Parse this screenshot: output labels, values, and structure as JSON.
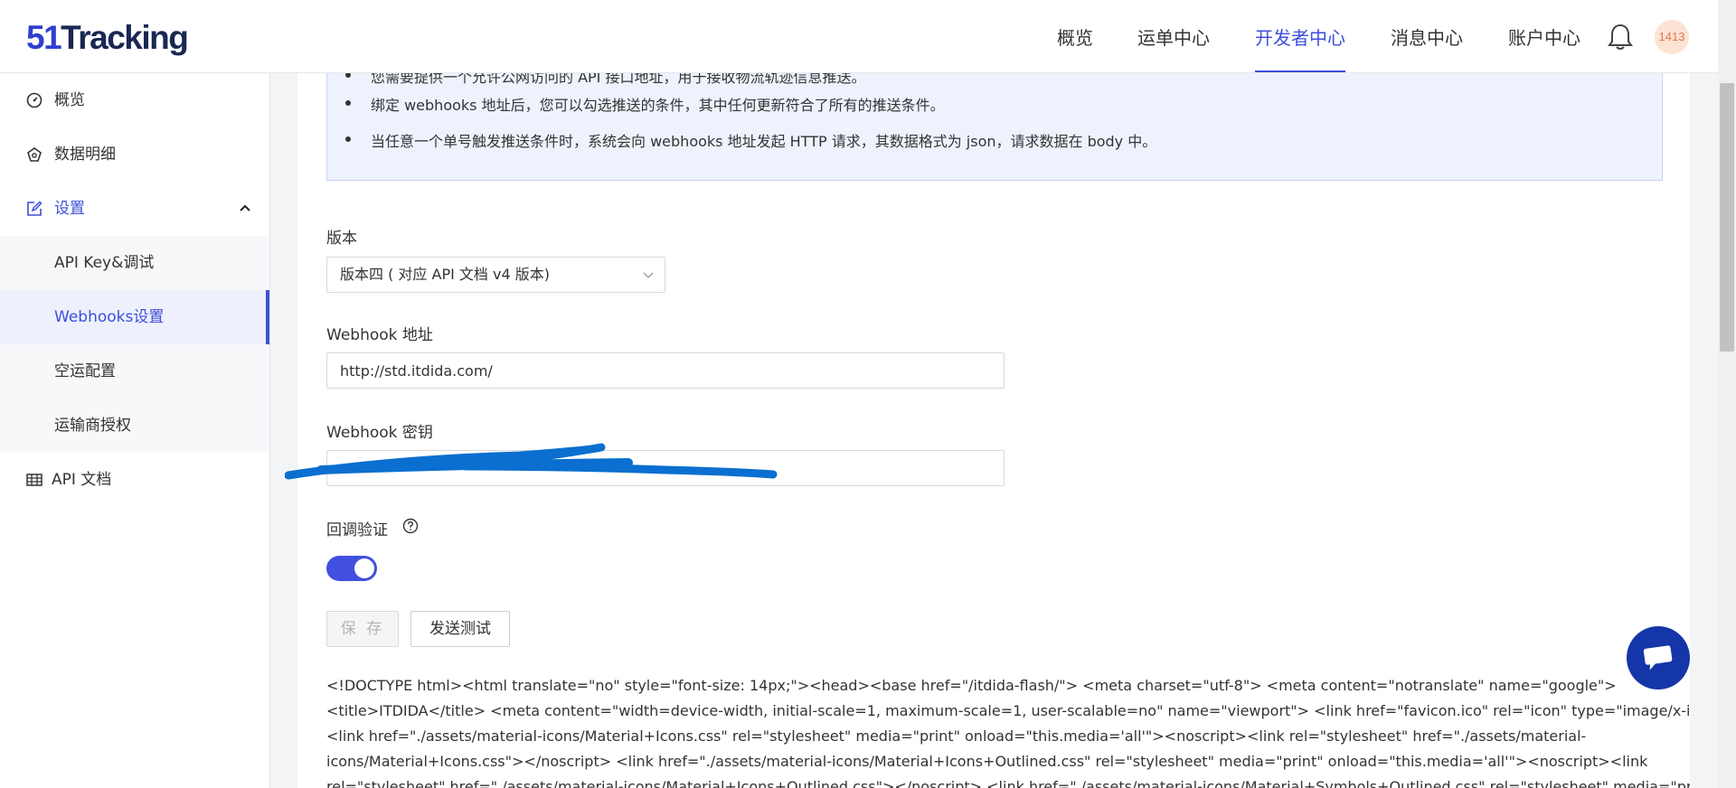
{
  "logo": {
    "num": "51",
    "text": "Tracking"
  },
  "nav": {
    "items": [
      {
        "label": "概览"
      },
      {
        "label": "运单中心"
      },
      {
        "label": "开发者中心",
        "active": true
      },
      {
        "label": "消息中心"
      },
      {
        "label": "账户中心"
      }
    ],
    "avatar_text": "1413"
  },
  "sidebar": {
    "items": [
      {
        "label": "概览",
        "icon": "dashboard-icon"
      },
      {
        "label": "数据明细",
        "icon": "data-icon"
      },
      {
        "label": "设置",
        "icon": "edit-icon",
        "expanded": true
      },
      {
        "label": "API Key&调试"
      },
      {
        "label": "Webhooks设置",
        "selected": true
      },
      {
        "label": "空运配置"
      },
      {
        "label": "运输商授权"
      },
      {
        "label": "API 文档",
        "icon": "table-icon"
      }
    ]
  },
  "info": {
    "lines": [
      "您需要提供一个允许公网访问的 API 接口地址，用于接收物流轨迹信息推送。",
      "绑定 webhooks 地址后，您可以勾选推送的条件，其中任何更新符合了所有的推送条件。",
      "当任意一个单号触发推送条件时，系统会向 webhooks 地址发起 HTTP 请求，其数据格式为 json，请求数据在 body 中。"
    ]
  },
  "form": {
    "version_label": "版本",
    "version_value": "版本四 ( 对应 API 文档 v4 版本)",
    "webhook_label": "Webhook 地址",
    "webhook_value": "http://std.itdida.com/",
    "secret_label": "Webhook 密钥",
    "callback_label": "回调验证",
    "callback_enabled": true,
    "save_label": "保 存",
    "test_label": "发送测试"
  },
  "code": {
    "lines": [
      "<!DOCTYPE html><html translate=\"no\" style=\"font-size: 14px;\"><head><base href=\"/itdida-flash/\"> <meta charset=\"utf-8\"> <meta content=\"notranslate\" name=\"google\">",
      "<title>ITDIDA</title> <meta content=\"width=device-width, initial-scale=1, maximum-scale=1, user-scalable=no\" name=\"viewport\"> <link href=\"favicon.ico\" rel=\"icon\" type=\"image/x-icon\">",
      "<link href=\"./assets/material-icons/Material+Icons.css\" rel=\"stylesheet\" media=\"print\" onload=\"this.media='all'\"><noscript><link rel=\"stylesheet\" href=\"./assets/material-",
      "icons/Material+Icons.css\"></noscript> <link href=\"./assets/material-icons/Material+Icons+Outlined.css\" rel=\"stylesheet\" media=\"print\" onload=\"this.media='all'\"><noscript><link",
      "rel=\"stylesheet\" href=\"./assets/material-icons/Material+Icons+Outlined.css\"></noscript> <link href=\"./assets/material-icons/Material+Symbols+Outlined.css\" rel=\"stylesheet\" media=\"print\""
    ]
  },
  "colors": {
    "accent": "#3c4fd9",
    "toggle": "#4150de",
    "chat": "#1536a8",
    "redaction": "#0a6fd0"
  }
}
